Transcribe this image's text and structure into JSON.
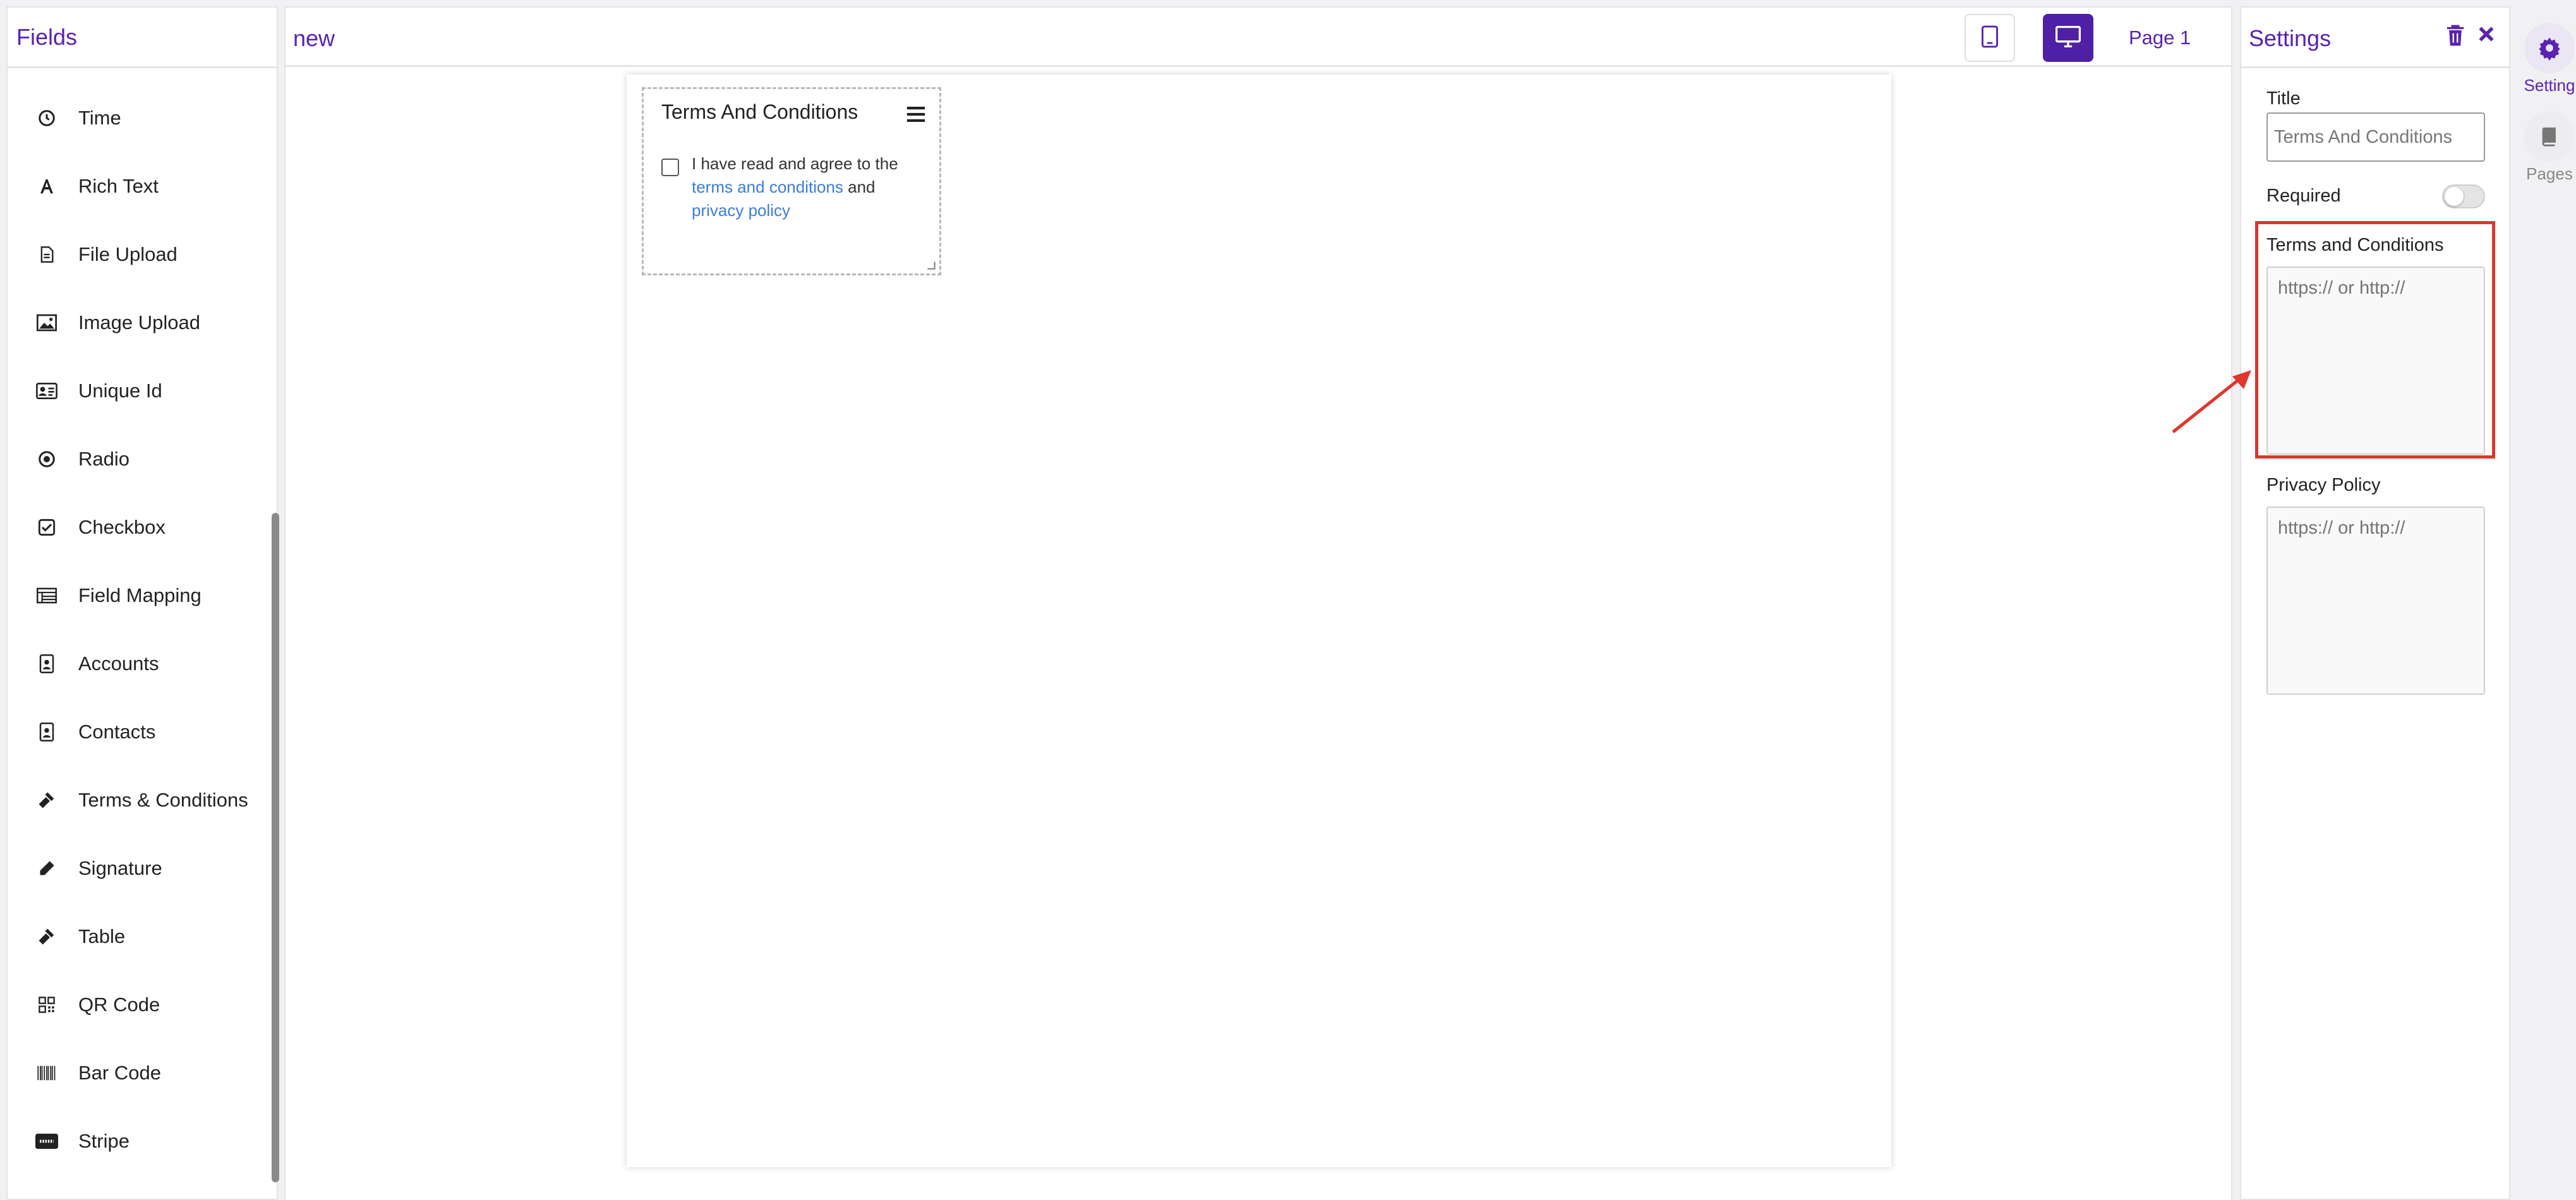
{
  "fields_panel": {
    "title": "Fields",
    "items": [
      {
        "label": "Time",
        "icon": "clock-icon"
      },
      {
        "label": "Rich Text",
        "icon": "font-icon"
      },
      {
        "label": "File Upload",
        "icon": "file-icon"
      },
      {
        "label": "Image Upload",
        "icon": "image-icon"
      },
      {
        "label": "Unique Id",
        "icon": "id-card-icon"
      },
      {
        "label": "Radio",
        "icon": "radio-icon"
      },
      {
        "label": "Checkbox",
        "icon": "checkbox-icon"
      },
      {
        "label": "Field Mapping",
        "icon": "table-list-icon"
      },
      {
        "label": "Accounts",
        "icon": "contact-badge-icon"
      },
      {
        "label": "Contacts",
        "icon": "contact-badge-icon"
      },
      {
        "label": "Terms & Conditions",
        "icon": "gavel-icon"
      },
      {
        "label": "Signature",
        "icon": "pen-icon"
      },
      {
        "label": "Table",
        "icon": "gavel-icon"
      },
      {
        "label": "QR Code",
        "icon": "qr-code-icon"
      },
      {
        "label": "Bar Code",
        "icon": "barcode-icon"
      },
      {
        "label": "Stripe",
        "icon": "stripe-icon"
      }
    ]
  },
  "topbar": {
    "form_name": "new",
    "page_label": "Page 1"
  },
  "canvas": {
    "card": {
      "title": "Terms And Conditions",
      "text_before": "I have read and agree to the",
      "link_terms": "terms and conditions",
      "text_and": "and",
      "link_privacy": "privacy policy"
    }
  },
  "settings": {
    "title": "Settings",
    "title_label": "Title",
    "title_value": "Terms And Conditions",
    "required_label": "Required",
    "required_on": false,
    "terms_label": "Terms and Conditions",
    "terms_placeholder": "https:// or http://",
    "privacy_label": "Privacy Policy",
    "privacy_placeholder": "https:// or http://"
  },
  "side_tabs": {
    "settings_label": "Setting",
    "pages_label": "Pages"
  },
  "colors": {
    "brand": "#5a22b0",
    "brand_dark": "#4f1fa6",
    "link": "#3c7dd6",
    "annotation": "#e0352b"
  }
}
